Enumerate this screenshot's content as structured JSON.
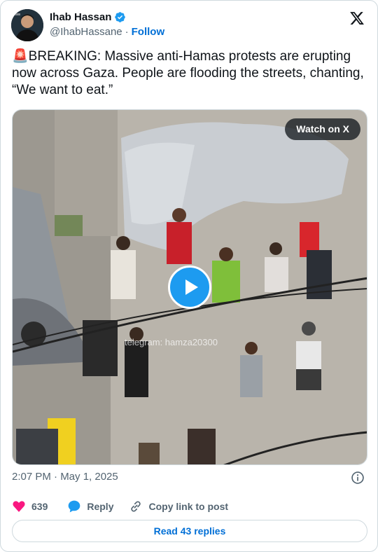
{
  "author": {
    "name": "Ihab Hassan",
    "handle": "@IhabHassane",
    "separator": "·",
    "follow_label": "Follow"
  },
  "post": {
    "emoji": "🚨",
    "text": "BREAKING: Massive anti-Hamas protests are erupting now across Gaza. People are flooding the streets, chanting, “We want to eat.”",
    "timestamp": "2:07 PM · May 1, 2025"
  },
  "media": {
    "watch_label": "Watch on X",
    "watermark": "telegram: hamza20300"
  },
  "actions": {
    "likes": "639",
    "reply_label": "Reply",
    "copy_label": "Copy link to post"
  },
  "footer": {
    "read_replies_label": "Read 43 replies"
  },
  "colors": {
    "accent": "#1d9bf0",
    "link": "#006fd6",
    "like": "#f91880"
  },
  "icons": [
    "verified-badge-icon",
    "x-logo-icon",
    "info-icon",
    "heart-icon",
    "reply-bubble-icon",
    "link-icon",
    "play-icon"
  ]
}
